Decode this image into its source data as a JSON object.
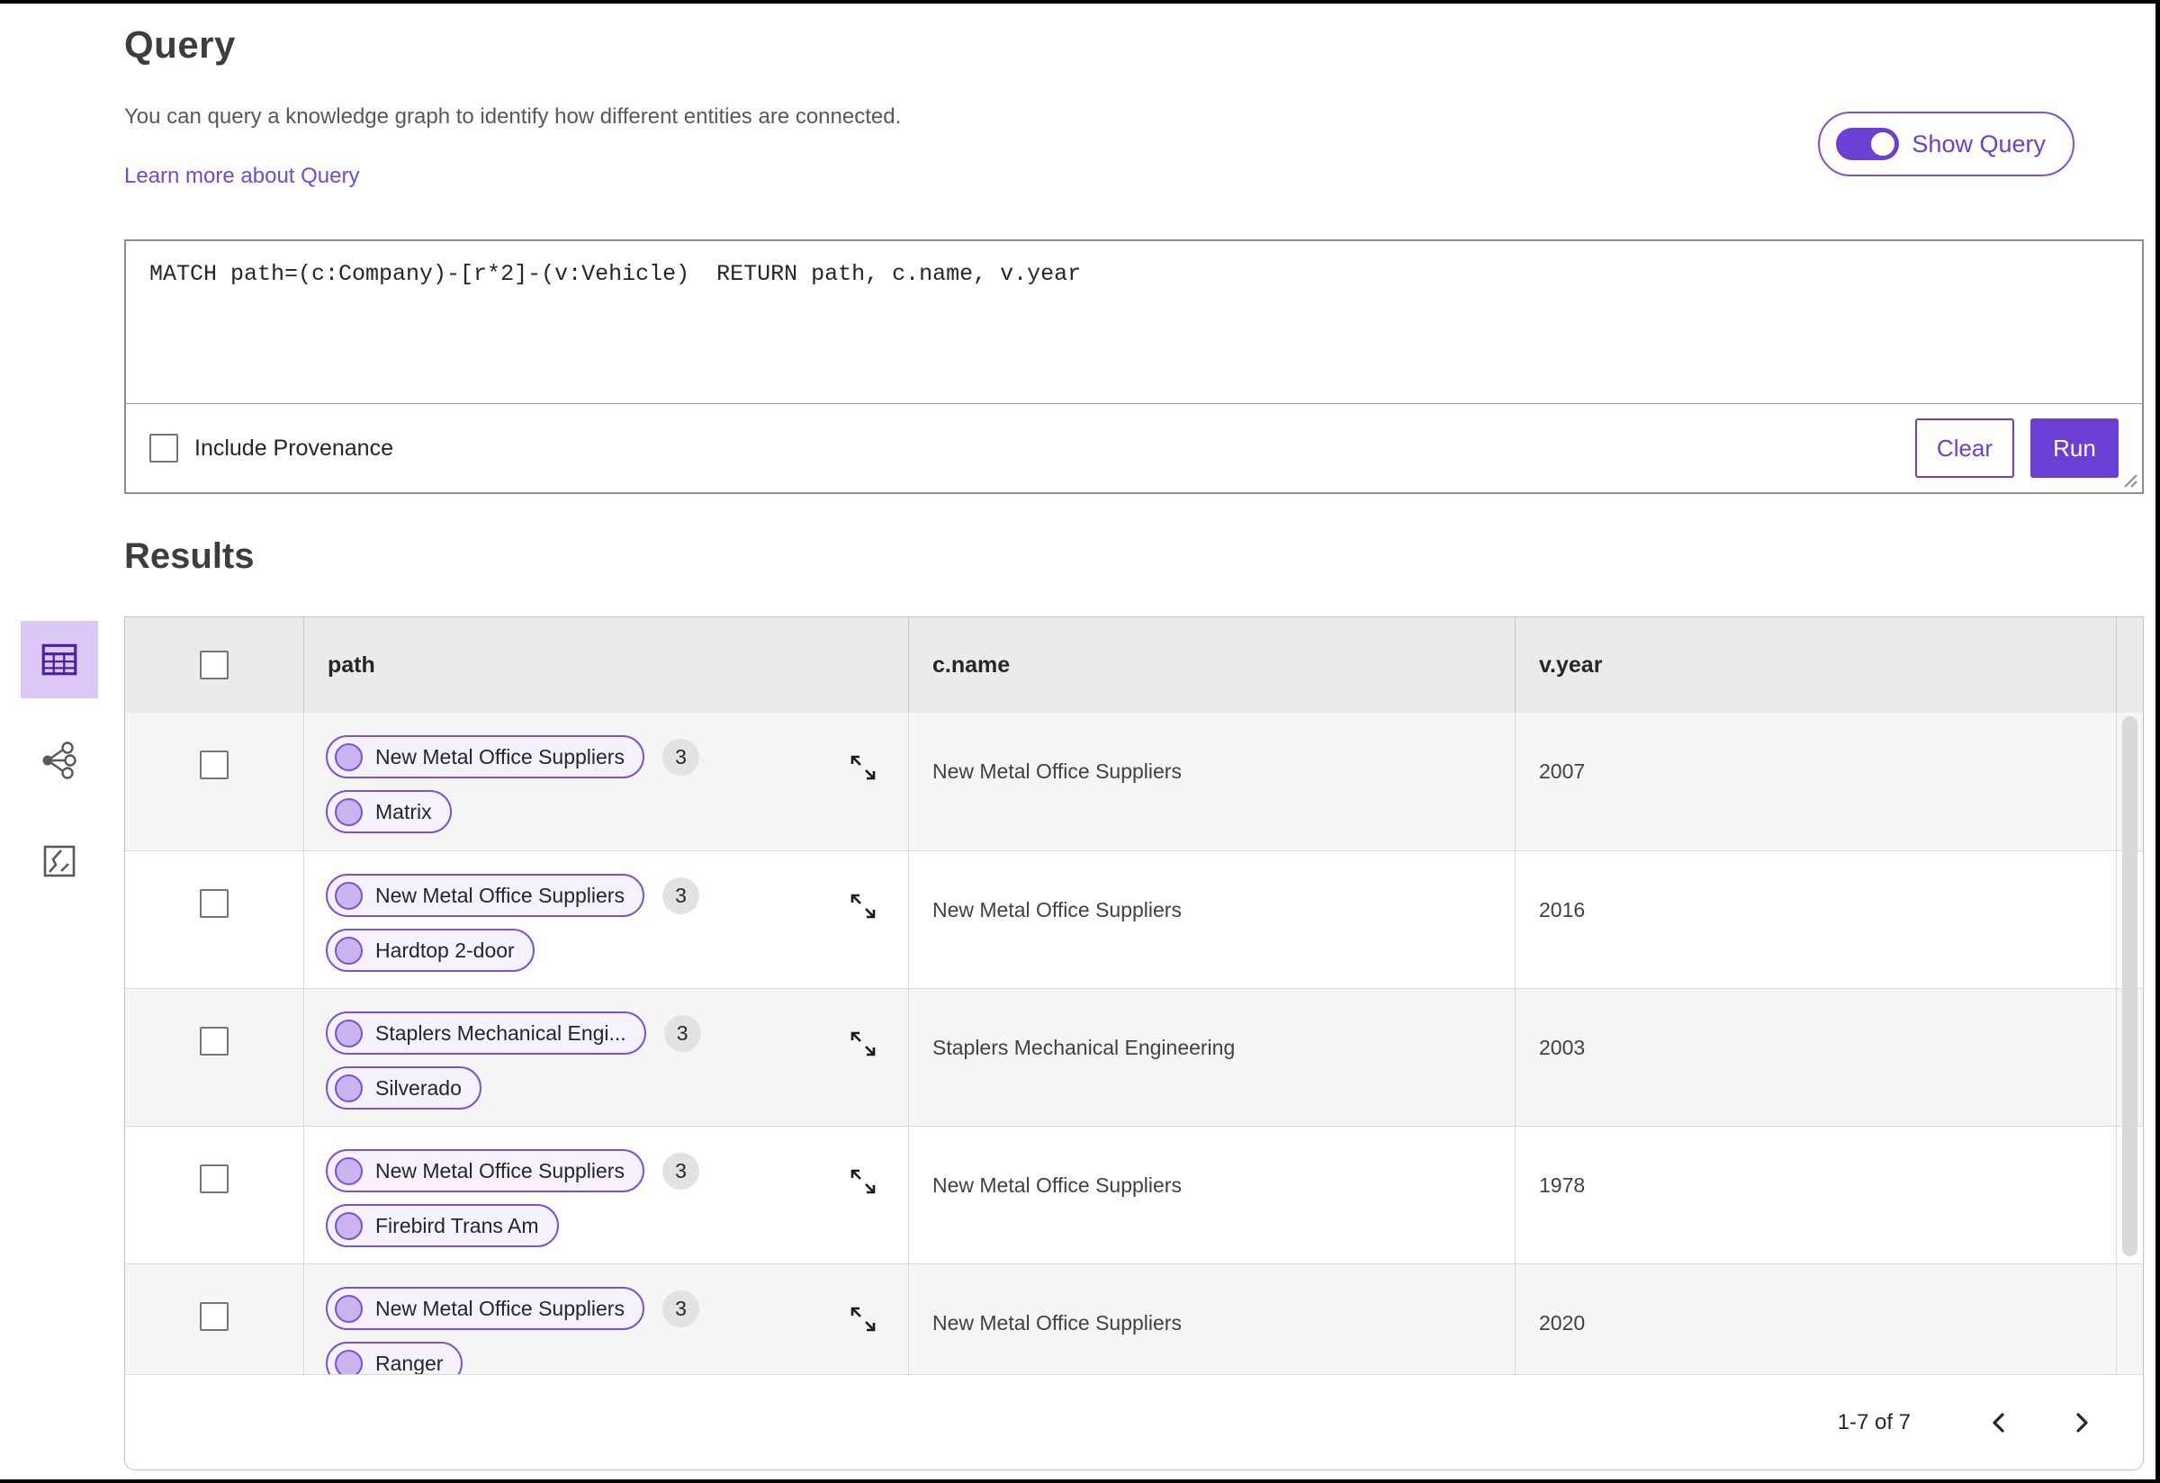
{
  "query_section": {
    "title": "Query",
    "description": "You can query a knowledge graph to identify how different entities are connected.",
    "learn_more_label": "Learn more about Query",
    "show_query_label": "Show Query",
    "show_query_on": true,
    "query_text": "MATCH path=(c:Company)-[r*2]-(v:Vehicle)  RETURN path, c.name, v.year",
    "include_provenance_label": "Include Provenance",
    "include_provenance_checked": false,
    "clear_label": "Clear",
    "run_label": "Run"
  },
  "results_section": {
    "title": "Results",
    "views": [
      "table-view",
      "graph-view",
      "map-view"
    ],
    "selected_view": "table-view",
    "table": {
      "columns": [
        "path",
        "c.name",
        "v.year"
      ],
      "select_all_checked": false,
      "rows": [
        {
          "path_nodes": [
            "New Metal Office Suppliers",
            "Matrix"
          ],
          "badge": "3",
          "c_name": "New Metal Office Suppliers",
          "v_year": "2007",
          "checked": false
        },
        {
          "path_nodes": [
            "New Metal Office Suppliers",
            "Hardtop 2-door"
          ],
          "badge": "3",
          "c_name": "New Metal Office Suppliers",
          "v_year": "2016",
          "checked": false
        },
        {
          "path_nodes": [
            "Staplers Mechanical Engi...",
            "Silverado"
          ],
          "badge": "3",
          "c_name": "Staplers Mechanical Engineering",
          "v_year": "2003",
          "checked": false
        },
        {
          "path_nodes": [
            "New Metal Office Suppliers",
            "Firebird Trans Am"
          ],
          "badge": "3",
          "c_name": "New Metal Office Suppliers",
          "v_year": "1978",
          "checked": false
        },
        {
          "path_nodes": [
            "New Metal Office Suppliers",
            "Ranger"
          ],
          "badge": "3",
          "c_name": "New Metal Office Suppliers",
          "v_year": "2020",
          "checked": false
        }
      ],
      "pagination": {
        "label": "1-7 of 7"
      }
    }
  },
  "colors": {
    "accent": "#6b3fd4",
    "accent_border": "#7b52d6",
    "link": "#7348d9",
    "pill_bg": "#f5f1fd",
    "pill_circle": "#c9b4ef",
    "selected_view_bg": "#dcc8f5",
    "selected_view_icon": "#4b1fa6",
    "header_bg": "#ebebeb",
    "row_alt_bg": "#f5f5f5",
    "badge_bg": "#e2e2e2"
  }
}
